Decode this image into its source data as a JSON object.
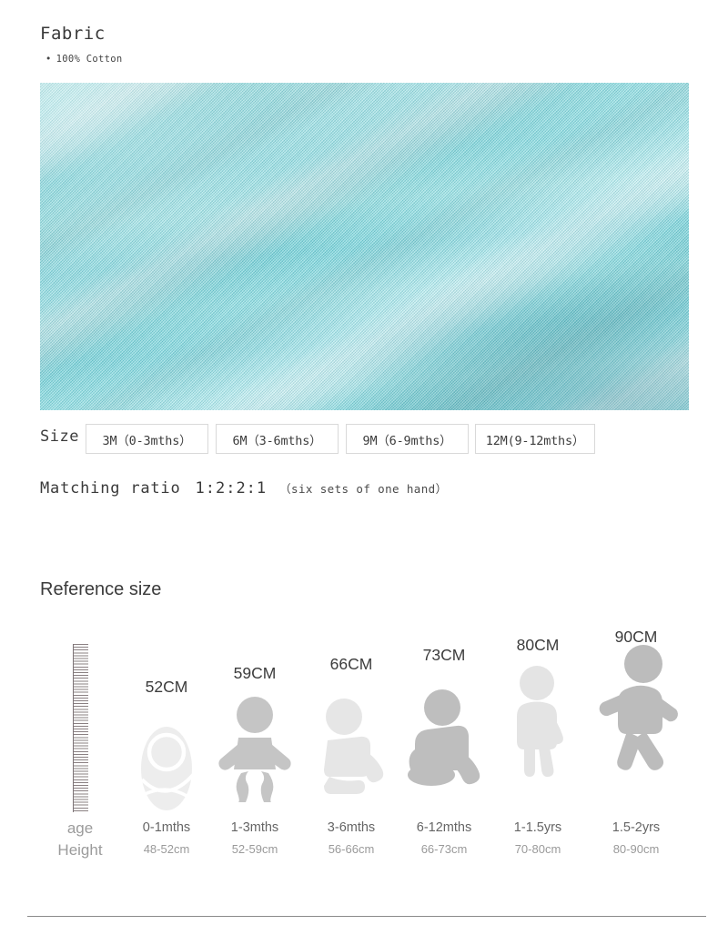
{
  "fabric": {
    "title": "Fabric",
    "bullet_marker": "•",
    "bullet_text": "100% Cotton",
    "photo_alt": "cyan-knit-cotton-fabric-closeup",
    "photo_color": "#7fe0e5"
  },
  "size": {
    "label": "Size",
    "options": [
      "3M（0-3mths）",
      "6M（3-6mths）",
      "9M（6-9mths）",
      "12M(9-12mths）"
    ]
  },
  "ratio": {
    "label": "Matching ratio",
    "value": "1:2:2:1",
    "note": "（six sets of one hand）"
  },
  "reference": {
    "title": "Reference size",
    "axis": {
      "ruler_name": "height-ruler",
      "age_caption": "age",
      "height_caption": "Height"
    },
    "columns": [
      {
        "cm": "52CM",
        "age": "0-1mths",
        "height": "48-52cm",
        "icon": "swaddled-baby-icon",
        "color": "#ededed"
      },
      {
        "cm": "59CM",
        "age": "1-3mths",
        "height": "52-59cm",
        "icon": "lying-baby-icon",
        "color": "#c5c5c5"
      },
      {
        "cm": "66CM",
        "age": "3-6mths",
        "height": "56-66cm",
        "icon": "sitting-baby-icon",
        "color": "#e6e6e6"
      },
      {
        "cm": "73CM",
        "age": "6-12mths",
        "height": "66-73cm",
        "icon": "crawling-baby-icon",
        "color": "#bebebe"
      },
      {
        "cm": "80CM",
        "age": "1-1.5yrs",
        "height": "70-80cm",
        "icon": "standing-child-icon",
        "color": "#e4e4e4"
      },
      {
        "cm": "90CM",
        "age": "1.5-2yrs",
        "height": "80-90cm",
        "icon": "walking-child-icon",
        "color": "#bcbcbc"
      }
    ]
  }
}
